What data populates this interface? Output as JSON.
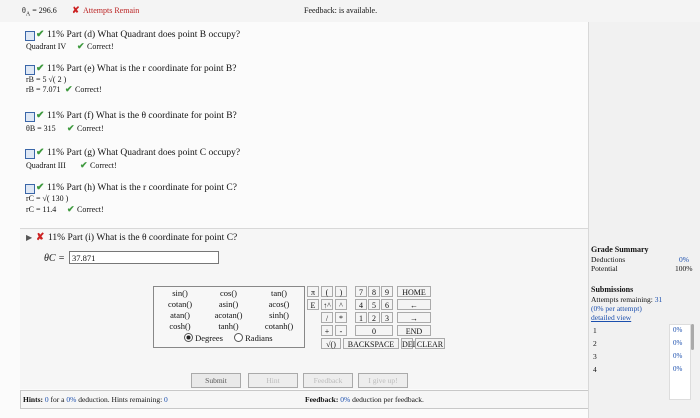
{
  "top": {
    "theta_a": "θ",
    "theta_a_sub": "A",
    "theta_a_rest": " = 296.6",
    "attempts_label": "Attempts Remain",
    "feedback_status": "Feedback: is available."
  },
  "parts": [
    {
      "pct": "11%",
      "label": "Part (d)",
      "question": "What Quadrant does point B occupy?",
      "answer_lines": [
        "Quadrant IV"
      ],
      "status": "Correct!"
    },
    {
      "pct": "11%",
      "label": "Part (e)",
      "question": "What is the r coordinate for point B?",
      "answer_lines": [
        "rB = 5 √( 2 )",
        "rB = 7.071"
      ],
      "status": "Correct!"
    },
    {
      "pct": "11%",
      "label": "Part (f)",
      "question": "What is the θ coordinate for point B?",
      "answer_lines": [
        "θB = 315"
      ],
      "status": "Correct!"
    },
    {
      "pct": "11%",
      "label": "Part (g)",
      "question": "What Quadrant does point C occupy?",
      "answer_lines": [
        "Quadrant III"
      ],
      "status": "Correct!"
    },
    {
      "pct": "11%",
      "label": "Part (h)",
      "question": "What is the r coordinate for point C?",
      "answer_lines": [
        "rC = √( 130 )",
        "rC = 11.4"
      ],
      "status": "Correct!"
    }
  ],
  "current": {
    "pct": "11%",
    "label": "Part (i)",
    "question": "What is the θ coordinate for point C?",
    "var": "θC =",
    "value": "37.871"
  },
  "functions": [
    "sin()",
    "cos()",
    "tan()",
    "cotan()",
    "asin()",
    "acos()",
    "atan()",
    "acotan()",
    "sinh()",
    "cosh()",
    "tanh()",
    "cotanh()"
  ],
  "angle_mode": {
    "degrees": "Degrees",
    "radians": "Radians"
  },
  "keypad": {
    "pi": "π",
    "open": "(",
    "close": ")",
    "e": "E",
    "pow": "↑^",
    "pow2": "^",
    "div": "/",
    "mul": "*",
    "plus": "+",
    "minus": "-",
    "sqrt": "√()",
    "dot": ".",
    "n7": "7",
    "n8": "8",
    "n9": "9",
    "n4": "4",
    "n5": "5",
    "n6": "6",
    "n1": "1",
    "n2": "2",
    "n3": "3",
    "n0": "0",
    "home": "HOME",
    "left": "←",
    "right": "→",
    "end": "END",
    "backspace": "BACKSPACE",
    "del": "DEL",
    "clear": "CLEAR"
  },
  "actions": {
    "submit": "Submit",
    "hint": "Hint",
    "feedback": "Feedback",
    "giveup": "I give up!"
  },
  "hints": {
    "label": "Hints:",
    "count": "0",
    "for_a": "for a",
    "pct": "0%",
    "rest": "deduction. Hints remaining:",
    "remaining": "0"
  },
  "feedback_bar": {
    "label": "Feedback:",
    "pct": "0%",
    "rest": "deduction per feedback."
  },
  "grade": {
    "title": "Grade Summary",
    "deductions_label": "Deductions",
    "deductions": "0%",
    "potential_label": "Potential",
    "potential": "100%"
  },
  "submissions": {
    "title": "Submissions",
    "remaining_label": "Attempts remaining:",
    "remaining": "31",
    "per_attempt": "(0% per attempt)",
    "detailed": "detailed view",
    "rows": [
      {
        "n": "1",
        "pct": "0%"
      },
      {
        "n": "2",
        "pct": "0%"
      },
      {
        "n": "3",
        "pct": "0%"
      },
      {
        "n": "4",
        "pct": "0%"
      }
    ]
  }
}
